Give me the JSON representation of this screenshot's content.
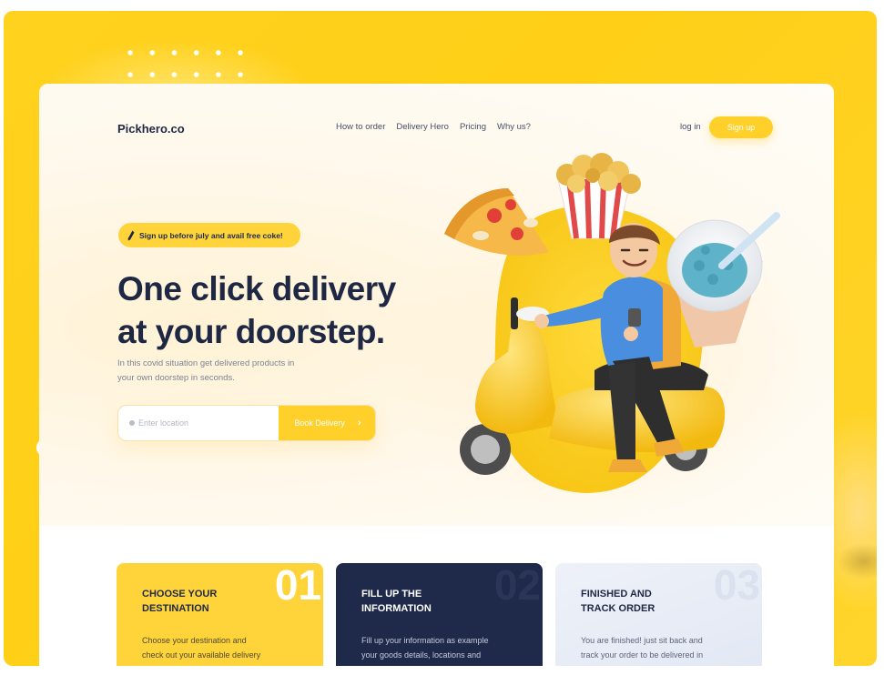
{
  "brand": {
    "logo": "Pickhero.co"
  },
  "nav": {
    "items": [
      "How to order",
      "Delivery Hero",
      "Pricing",
      "Why us?"
    ]
  },
  "auth": {
    "login_label": "log in",
    "signup_label": "Sign up"
  },
  "hero": {
    "promo": "Sign up before july and avail free coke!",
    "headline_line1": "One click delivery",
    "headline_line2": "at your doorstep.",
    "subtext_line1": "In this covid situation get delivered products in",
    "subtext_line2": "your own doorstep in seconds.",
    "search_placeholder": "Enter location",
    "search_value": "",
    "cta_label": "Book Delivery",
    "cta_icon": "chevron-right-icon"
  },
  "steps": [
    {
      "number": "01",
      "title_line1": "CHOOSE YOUR",
      "title_line2": "DESTINATION",
      "desc_line1": "Choose your destination and",
      "desc_line2": "check out your available delivery"
    },
    {
      "number": "02",
      "title_line1": "FILL UP THE",
      "title_line2": "INFORMATION",
      "desc_line1": "Fill up your information as example",
      "desc_line2": "your goods details, locations and"
    },
    {
      "number": "03",
      "title_line1": "FINISHED AND",
      "title_line2": "TRACK ORDER",
      "desc_line1": "You are finished! just sit back and",
      "desc_line2": "track your order to be delivered in"
    }
  ],
  "colors": {
    "primary_yellow": "#ffd02a",
    "navy": "#1e2844",
    "step2_bg": "#1f2a4a",
    "step3_bg": "#e8ecf5"
  }
}
